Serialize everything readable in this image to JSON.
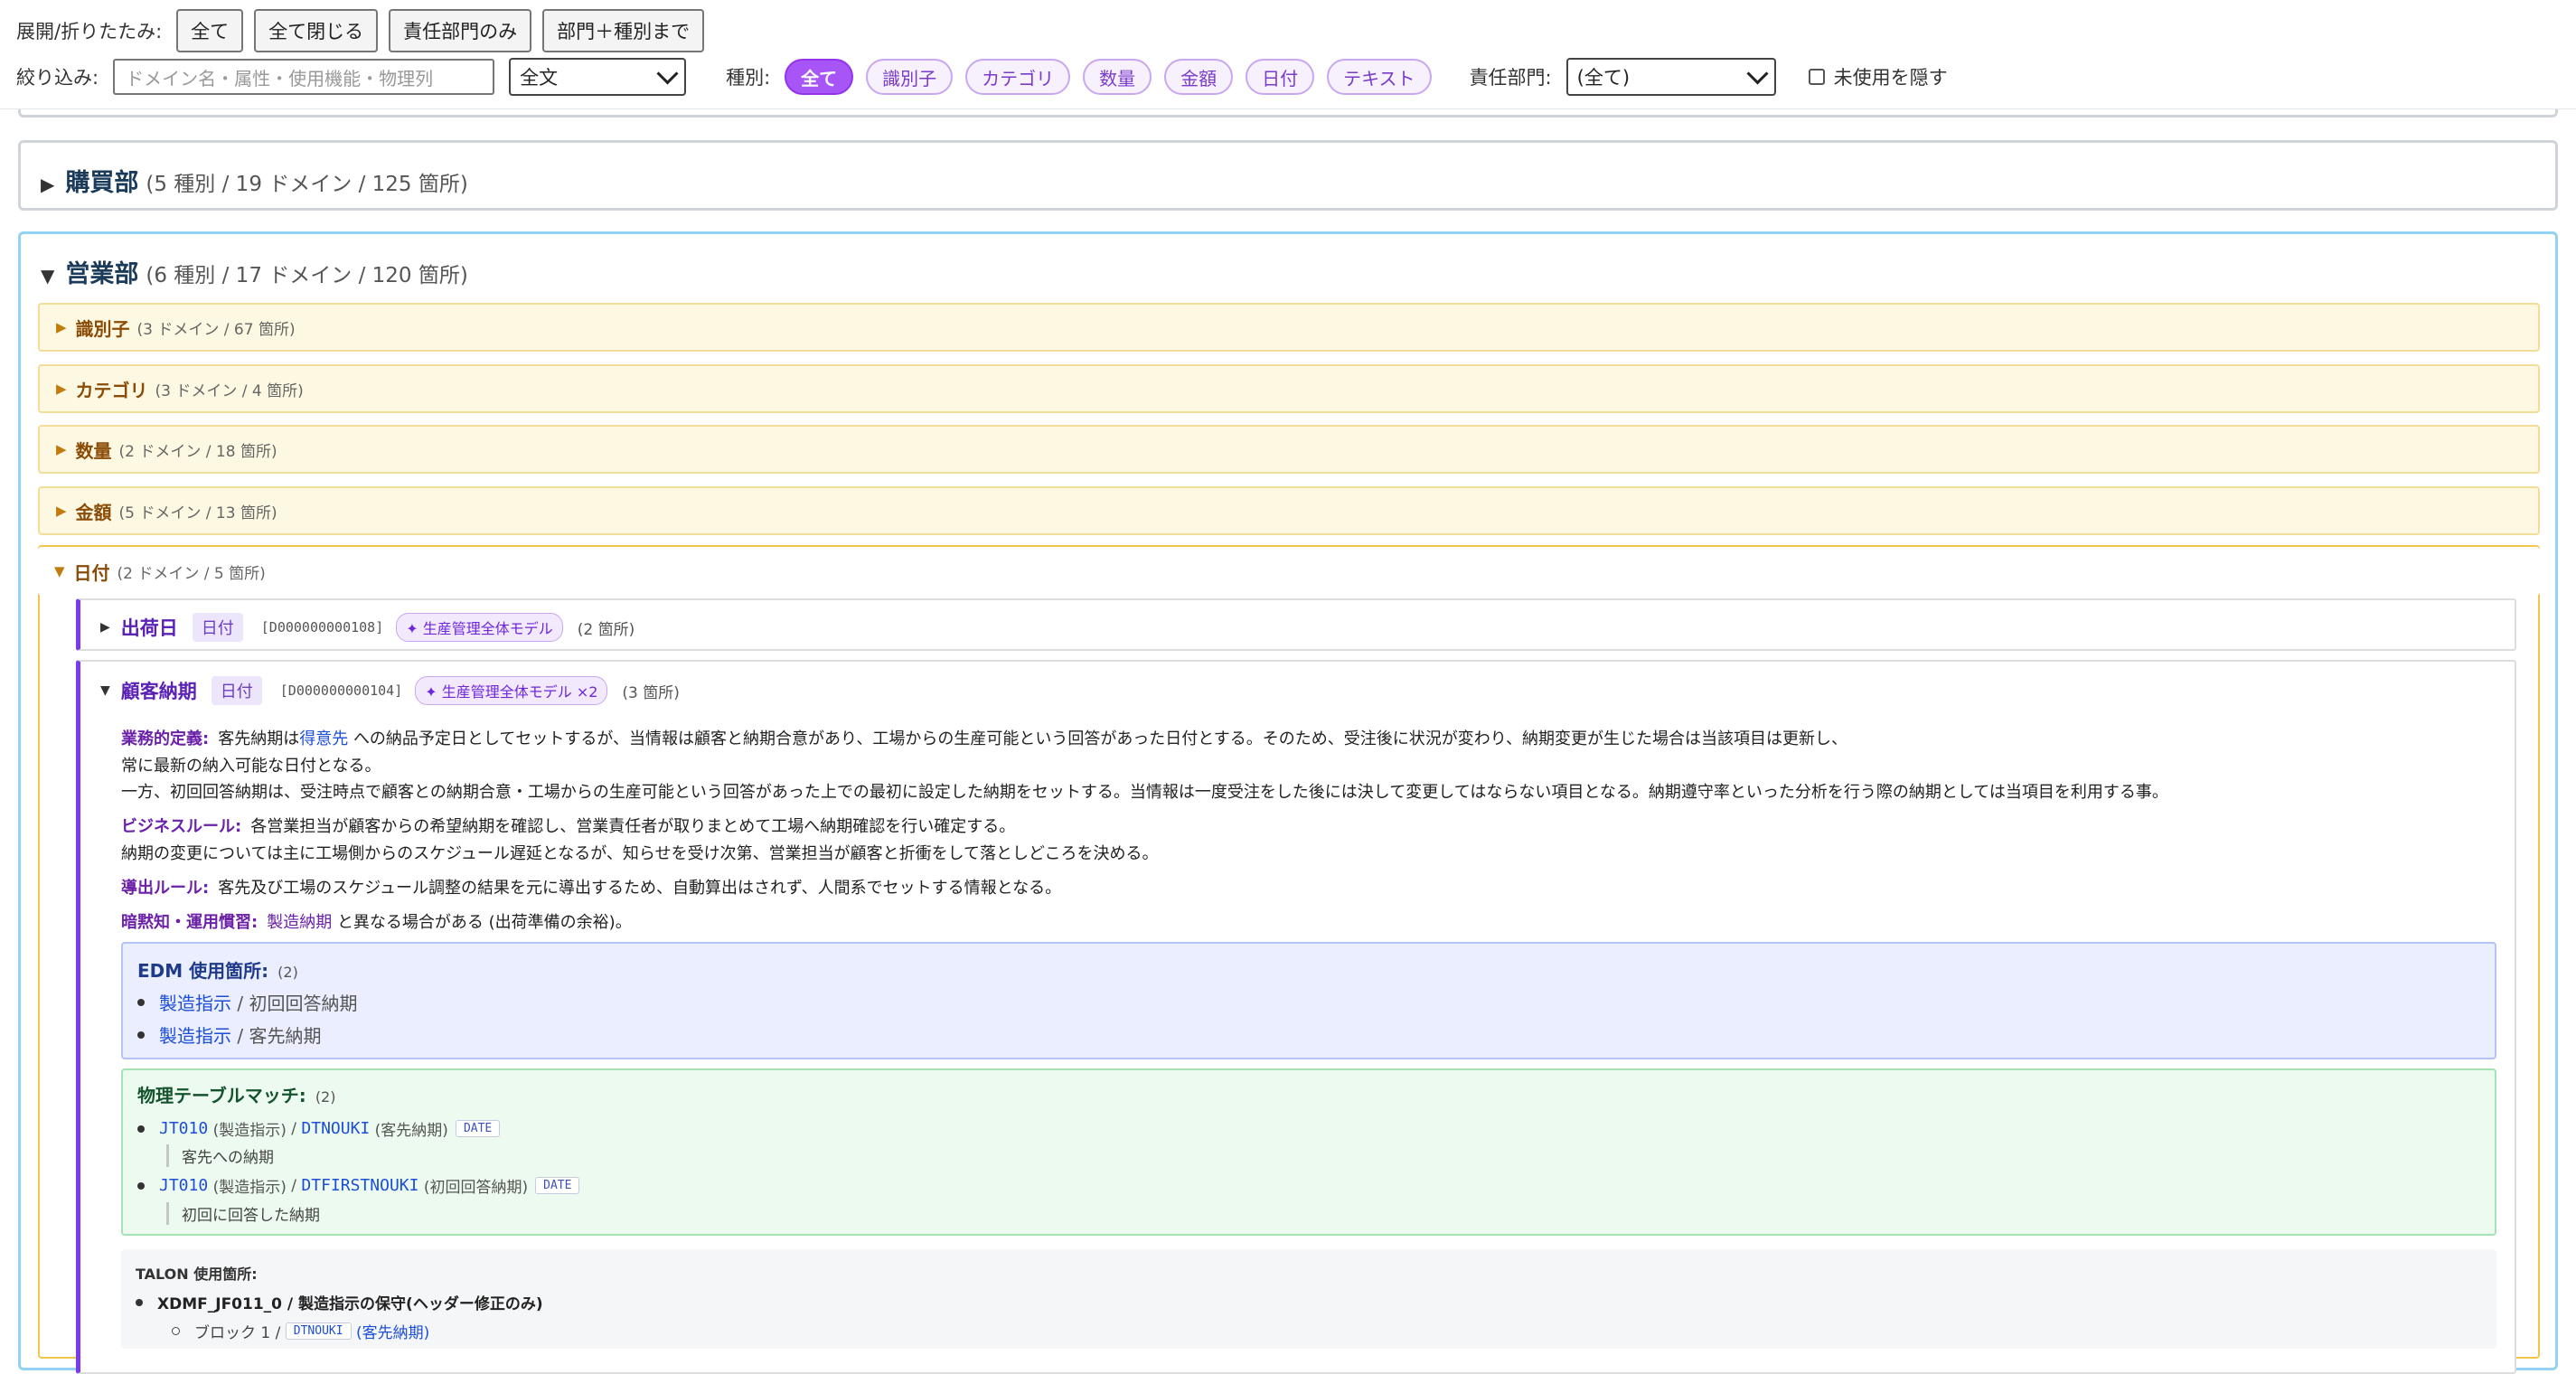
{
  "toolbar": {
    "expand_label": "展開/折りたたみ:",
    "buttons": [
      "全て",
      "全て閉じる",
      "責任部門のみ",
      "部門＋種別まで"
    ],
    "filter_label": "絞り込み:",
    "filter_placeholder": "ドメイン名・属性・使用機能・物理列",
    "scope_select": "全文",
    "kind_label": "種別:",
    "kind_chips": [
      "全て",
      "識別子",
      "カテゴリ",
      "数量",
      "金額",
      "日付",
      "テキスト"
    ],
    "kind_active": "全て",
    "dept_label": "責任部門:",
    "dept_select": "(全て)",
    "hide_unused_label": "未使用を隠す"
  },
  "departments": [
    {
      "name": "購買部",
      "stats": "(5 種別 / 19 ドメイン / 125 箇所)",
      "expanded": false
    },
    {
      "name": "営業部",
      "stats": "(6 種別 / 17 ドメイン / 120 箇所)",
      "expanded": true
    }
  ],
  "categories": [
    {
      "name": "識別子",
      "stats": "(3 ドメイン / 67 箇所)"
    },
    {
      "name": "カテゴリ",
      "stats": "(3 ドメイン / 4 箇所)"
    },
    {
      "name": "数量",
      "stats": "(2 ドメイン / 18 箇所)"
    },
    {
      "name": "金額",
      "stats": "(5 ドメイン / 13 箇所)"
    },
    {
      "name": "日付",
      "stats": "(2 ドメイン / 5 箇所)"
    }
  ],
  "domains": [
    {
      "name": "出荷日",
      "type": "日付",
      "id": "[D000000000108]",
      "model": "✦ 生産管理全体モデル",
      "count": "(2 箇所)"
    },
    {
      "name": "顧客納期",
      "type": "日付",
      "id": "[D000000000104]",
      "model": "✦ 生産管理全体モデル ×2",
      "count": "(3 箇所)"
    }
  ],
  "definition": {
    "biz_def_key": "業務的定義:",
    "biz_def_1a": "客先納期は",
    "biz_def_1_link": "得意先",
    "biz_def_1b": "への納品予定日としてセットするが、当情報は顧客と納期合意があり、工場からの生産可能という回答があった日付とする。そのため、受注後に状況が変わり、納期変更が生じた場合は当該項目は更新し、",
    "biz_def_2": "常に最新の納入可能な日付となる。",
    "biz_def_3": "一方、初回回答納期は、受注時点で顧客との納期合意・工場からの生産可能という回答があった上での最初に設定した納期をセットする。当情報は一度受注をした後には決して変更してはならない項目となる。納期遵守率といった分析を行う際の納期としては当項目を利用する事。",
    "rule_key": "ビジネスルール:",
    "rule_1": "各営業担当が顧客からの希望納期を確認し、営業責任者が取りまとめて工場へ納期確認を行い確定する。",
    "rule_2": "納期の変更については主に工場側からのスケジュール遅延となるが、知らせを受け次第、営業担当が顧客と折衝をして落としどころを決める。",
    "derive_key": "導出ルール:",
    "derive_1": "客先及び工場のスケジュール調整の結果を元に導出するため、自動算出はされず、人間系でセットする情報となる。",
    "tacit_key": "暗黙知・運用慣習:",
    "tacit_link": "製造納期",
    "tacit_rest": "と異なる場合がある (出荷準備の余裕)。"
  },
  "edm": {
    "title": "EDM 使用箇所:",
    "count": "(2)",
    "items": [
      {
        "link": "製造指示",
        "rest": "/ 初回回答納期"
      },
      {
        "link": "製造指示",
        "rest": "/ 客先納期"
      }
    ]
  },
  "physical": {
    "title": "物理テーブルマッチ:",
    "count": "(2)",
    "items": [
      {
        "table": "JT010",
        "table_name": "(製造指示)",
        "sep": "/",
        "column": "DTNOUKI",
        "column_name": "(客先納期)",
        "dtype": "DATE",
        "note": "客先への納期"
      },
      {
        "table": "JT010",
        "table_name": "(製造指示)",
        "sep": "/",
        "column": "DTFIRSTNOUKI",
        "column_name": "(初回回答納期)",
        "dtype": "DATE",
        "note": "初回に回答した納期"
      }
    ]
  },
  "talon": {
    "title": "TALON 使用箇所:",
    "item": "XDMF_JF011_0 / 製造指示の保守(ヘッダー修正のみ)",
    "sub_prefix": "ブロック 1 /",
    "sub_code": "DTNOUKI",
    "sub_name": "(客先納期)"
  }
}
